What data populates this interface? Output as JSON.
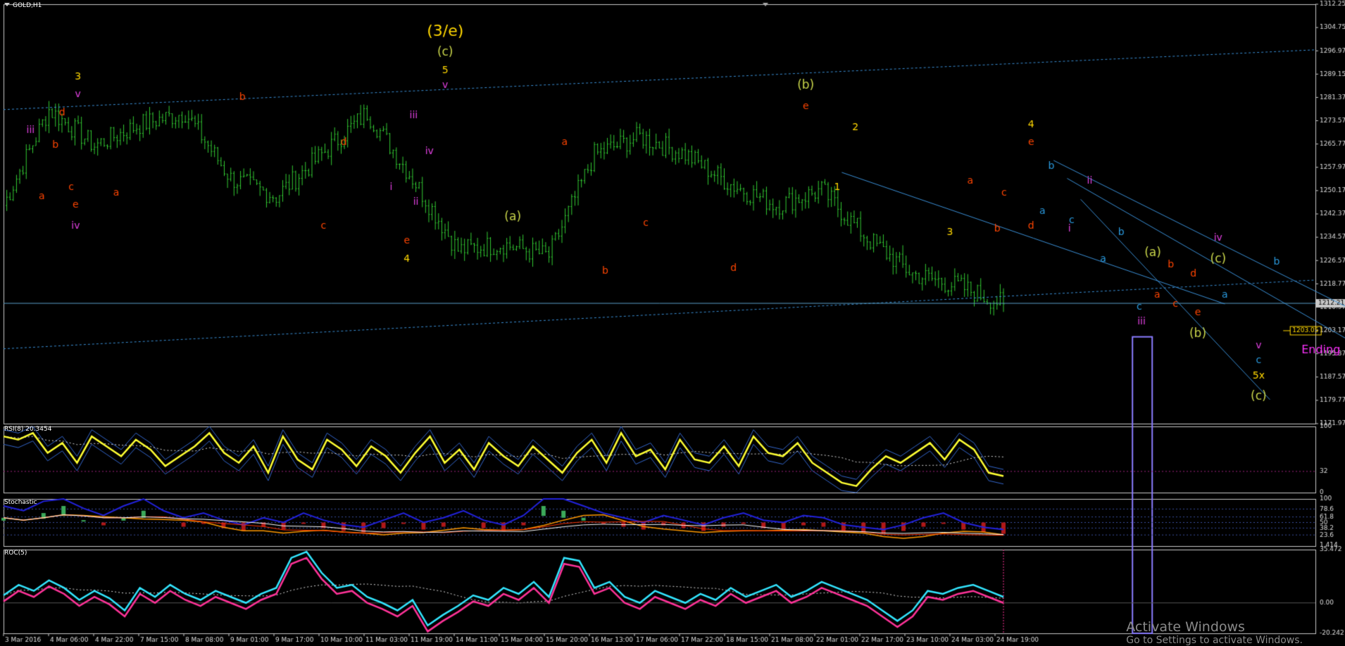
{
  "app": {
    "symbol": "GOLD,H1"
  },
  "panels": {
    "rsi_label": "RSI(8) 20.3454",
    "stoch_label": "Stochastic",
    "roc_label": "ROC(5)"
  },
  "price_axis": {
    "ticks": [
      "1312.25",
      "1304.75",
      "1296.97",
      "1289.15",
      "1281.37",
      "1273.57",
      "1265.77",
      "1257.97",
      "1250.17",
      "1242.37",
      "1234.57",
      "1226.57",
      "1218.77",
      "1210.97",
      "1203.17",
      "1195.37",
      "1187.57",
      "1179.77",
      "1171.97"
    ],
    "current_price": "1212.21",
    "target_label": "1203.05"
  },
  "rsi_axis": [
    "100",
    "32",
    "0"
  ],
  "stoch_axis": [
    "100",
    "78.6",
    "61.8",
    "50",
    "38.2",
    "23.6",
    "1.414"
  ],
  "roc_axis": [
    "35.472",
    "0.00",
    "-20.242"
  ],
  "time_axis": [
    "3 Mar 2016",
    "4 Mar 06:00",
    "4 Mar 22:00",
    "7 Mar 15:00",
    "8 Mar 08:00",
    "9 Mar 01:00",
    "9 Mar 17:00",
    "10 Mar 10:00",
    "11 Mar 03:00",
    "11 Mar 19:00",
    "14 Mar 11:00",
    "15 Mar 04:00",
    "15 Mar 20:00",
    "16 Mar 13:00",
    "17 Mar 06:00",
    "17 Mar 22:00",
    "18 Mar 15:00",
    "21 Mar 08:00",
    "22 Mar 01:00",
    "22 Mar 17:00",
    "23 Mar 10:00",
    "24 Mar 03:00",
    "24 Mar 19:00"
  ],
  "annotation": "Ending Diagonal",
  "watermark": {
    "line1": "Activate Windows",
    "line2": "Go to Settings to activate Windows."
  },
  "colors": {
    "background": "#000000",
    "candles": "#33cc33",
    "rsi": "#ffff33",
    "roc_fast": "#33e6ff",
    "roc_slow": "#ff3399",
    "channel": "#3a8fd6",
    "highlight_box": "#8a7cff",
    "wave_yellow": "#ffd700",
    "wave_olive": "#c8d44a",
    "wave_orange": "#ff4500",
    "wave_magenta": "#e040e0",
    "wave_cyan": "#2a9be0",
    "annotation": "#ff33ff"
  },
  "chart_data": [
    {
      "type": "line",
      "name": "GOLD H1 price",
      "ylim": [
        1171.97,
        1312.25
      ],
      "x": [
        "3 Mar 2016",
        "4 Mar 06:00",
        "4 Mar 22:00",
        "7 Mar 15:00",
        "8 Mar 08:00",
        "9 Mar 01:00",
        "9 Mar 17:00",
        "10 Mar 10:00",
        "11 Mar 03:00",
        "11 Mar 19:00",
        "14 Mar 11:00",
        "15 Mar 04:00",
        "15 Mar 20:00",
        "16 Mar 13:00",
        "17 Mar 06:00",
        "17 Mar 22:00",
        "18 Mar 15:00",
        "21 Mar 08:00",
        "22 Mar 01:00",
        "22 Mar 17:00",
        "23 Mar 10:00",
        "24 Mar 03:00",
        "24 Mar 19:00"
      ],
      "y": [
        1245,
        1277,
        1265,
        1272,
        1276,
        1254,
        1248,
        1262,
        1276,
        1254,
        1230,
        1232,
        1228,
        1262,
        1268,
        1262,
        1252,
        1245,
        1250,
        1234,
        1222,
        1218,
        1212
      ],
      "waves": [
        {
          "label": "(3/e)",
          "color": "#ffd700",
          "t": 9.8,
          "p": 1303
        },
        {
          "label": "(c)",
          "color": "#c8d44a",
          "t": 9.8,
          "p": 1296
        },
        {
          "label": "5",
          "color": "#ffd700",
          "t": 9.8,
          "p": 1290
        },
        {
          "label": "v",
          "color": "#e040e0",
          "t": 9.8,
          "p": 1285
        },
        {
          "label": "3",
          "color": "#ffd700",
          "t": 1.65,
          "p": 1288
        },
        {
          "label": "v",
          "color": "#e040e0",
          "t": 1.65,
          "p": 1282
        },
        {
          "label": "iii",
          "color": "#e040e0",
          "t": 0.6,
          "p": 1270
        },
        {
          "label": "d",
          "color": "#ff4500",
          "t": 1.3,
          "p": 1276
        },
        {
          "label": "b",
          "color": "#ff4500",
          "t": 1.15,
          "p": 1265
        },
        {
          "label": "c",
          "color": "#ff4500",
          "t": 1.5,
          "p": 1251
        },
        {
          "label": "a",
          "color": "#ff4500",
          "t": 0.85,
          "p": 1248
        },
        {
          "label": "e",
          "color": "#ff4500",
          "t": 1.6,
          "p": 1245
        },
        {
          "label": "iv",
          "color": "#e040e0",
          "t": 1.6,
          "p": 1238
        },
        {
          "label": "a",
          "color": "#ff4500",
          "t": 2.5,
          "p": 1249
        },
        {
          "label": "b",
          "color": "#ff4500",
          "t": 5.3,
          "p": 1281
        },
        {
          "label": "d",
          "color": "#ff4500",
          "t": 7.55,
          "p": 1266
        },
        {
          "label": "c",
          "color": "#ff4500",
          "t": 7.1,
          "p": 1238
        },
        {
          "label": "i",
          "color": "#e040e0",
          "t": 8.6,
          "p": 1251
        },
        {
          "label": "ii",
          "color": "#e040e0",
          "t": 9.15,
          "p": 1246
        },
        {
          "label": "iii",
          "color": "#e040e0",
          "t": 9.1,
          "p": 1275
        },
        {
          "label": "iv",
          "color": "#e040e0",
          "t": 9.45,
          "p": 1263
        },
        {
          "label": "e",
          "color": "#ff4500",
          "t": 8.95,
          "p": 1233
        },
        {
          "label": "4",
          "color": "#ffd700",
          "t": 8.95,
          "p": 1227
        },
        {
          "label": "(a)",
          "color": "#c8d44a",
          "t": 11.3,
          "p": 1241
        },
        {
          "label": "a",
          "color": "#ff4500",
          "t": 12.45,
          "p": 1266
        },
        {
          "label": "c",
          "color": "#ff4500",
          "t": 14.25,
          "p": 1239
        },
        {
          "label": "b",
          "color": "#ff4500",
          "t": 13.35,
          "p": 1223
        },
        {
          "label": "d",
          "color": "#ff4500",
          "t": 16.2,
          "p": 1224
        },
        {
          "label": "(b)",
          "color": "#c8d44a",
          "t": 17.8,
          "p": 1285
        },
        {
          "label": "e",
          "color": "#ff4500",
          "t": 17.8,
          "p": 1278
        },
        {
          "label": "2",
          "color": "#ffd700",
          "t": 18.9,
          "p": 1271
        },
        {
          "label": "1",
          "color": "#ffd700",
          "t": 18.5,
          "p": 1251
        },
        {
          "label": "3",
          "color": "#ffd700",
          "t": 21,
          "p": 1236
        },
        {
          "label": "a",
          "color": "#ff4500",
          "t": 21.45,
          "p": 1253
        },
        {
          "label": "c",
          "color": "#ff4500",
          "t": 22.2,
          "p": 1249
        },
        {
          "label": "b",
          "color": "#ff4500",
          "t": 22.05,
          "p": 1237
        },
        {
          "label": "d",
          "color": "#ff4500",
          "t": 22.8,
          "p": 1238
        },
        {
          "label": "4",
          "color": "#ffd700",
          "t": 22.8,
          "p": 1272
        },
        {
          "label": "e",
          "color": "#ff4500",
          "t": 22.8,
          "p": 1266
        },
        {
          "label": "ii",
          "color": "#e040e0",
          "t": 24.1,
          "p": 1253
        },
        {
          "label": "i",
          "color": "#e040e0",
          "t": 23.65,
          "p": 1237
        },
        {
          "label": "(a)",
          "color": "#c8d44a",
          "t": 25.5,
          "p": 1229
        },
        {
          "label": "b",
          "color": "#ff4500",
          "t": 25.9,
          "p": 1225
        },
        {
          "label": "d",
          "color": "#ff4500",
          "t": 26.4,
          "p": 1222
        },
        {
          "label": "a",
          "color": "#ff4500",
          "t": 25.6,
          "p": 1215
        },
        {
          "label": "c",
          "color": "#ff4500",
          "t": 26,
          "p": 1212
        },
        {
          "label": "e",
          "color": "#ff4500",
          "t": 26.5,
          "p": 1209
        },
        {
          "label": "iii",
          "color": "#e040e0",
          "t": 25.25,
          "p": 1206
        },
        {
          "label": "(b)",
          "color": "#c8d44a",
          "t": 26.5,
          "p": 1202
        },
        {
          "label": "(c)",
          "color": "#c8d44a",
          "t": 26.95,
          "p": 1227
        },
        {
          "label": "iv",
          "color": "#e040e0",
          "t": 26.95,
          "p": 1234
        },
        {
          "label": "v",
          "color": "#e040e0",
          "t": 27.85,
          "p": 1198
        },
        {
          "label": "5x",
          "color": "#ffd700",
          "t": 27.85,
          "p": 1188
        },
        {
          "label": "(c)",
          "color": "#c8d44a",
          "t": 27.85,
          "p": 1181
        },
        {
          "label": "b",
          "color": "#2a9be0",
          "t": 23.25,
          "p": 1258
        },
        {
          "label": "a",
          "color": "#2a9be0",
          "t": 23.05,
          "p": 1243
        },
        {
          "label": "c",
          "color": "#2a9be0",
          "t": 23.7,
          "p": 1240
        },
        {
          "label": "b",
          "color": "#2a9be0",
          "t": 24.8,
          "p": 1236
        },
        {
          "label": "a",
          "color": "#2a9be0",
          "t": 24.4,
          "p": 1227
        },
        {
          "label": "c",
          "color": "#2a9be0",
          "t": 25.2,
          "p": 1211
        },
        {
          "label": "a",
          "color": "#2a9be0",
          "t": 27.1,
          "p": 1215
        },
        {
          "label": "b",
          "color": "#2a9be0",
          "t": 28.25,
          "p": 1226
        },
        {
          "label": "c",
          "color": "#2a9be0",
          "t": 27.85,
          "p": 1193
        }
      ]
    },
    {
      "type": "line",
      "name": "RSI(8)",
      "ylim": [
        0,
        100
      ],
      "y": [
        85,
        80,
        90,
        60,
        75,
        45,
        85,
        70,
        55,
        80,
        65,
        40,
        55,
        70,
        90,
        60,
        45,
        70,
        30,
        85,
        50,
        35,
        80,
        65,
        40,
        70,
        55,
        30,
        60,
        85,
        45,
        65,
        35,
        75,
        55,
        40,
        70,
        50,
        30,
        60,
        80,
        45,
        90,
        55,
        65,
        35,
        80,
        50,
        45,
        70,
        40,
        85,
        60,
        55,
        75,
        45,
        30,
        15,
        10,
        35,
        55,
        45,
        60,
        75,
        50,
        80,
        65,
        30,
        25
      ]
    },
    {
      "type": "line",
      "name": "Stochastic",
      "ylim": [
        0,
        100
      ],
      "y": [
        60,
        50,
        70,
        85,
        55,
        40,
        60,
        75,
        50,
        35,
        45,
        30,
        20,
        35,
        25,
        45,
        30,
        20,
        15,
        30,
        45,
        25,
        35,
        50,
        30,
        20,
        40,
        85,
        75,
        60,
        45,
        35,
        25,
        40,
        30,
        20,
        35,
        45,
        30,
        25,
        40,
        35,
        20,
        15,
        10,
        20,
        35,
        45,
        25,
        15,
        10
      ]
    },
    {
      "type": "line",
      "name": "ROC(5)",
      "ylim": [
        -20.242,
        35.472
      ],
      "y": [
        5,
        12,
        8,
        15,
        10,
        2,
        8,
        3,
        -5,
        10,
        4,
        12,
        6,
        2,
        8,
        4,
        0,
        6,
        10,
        30,
        34,
        20,
        10,
        12,
        4,
        0,
        -5,
        2,
        -15,
        -8,
        -2,
        5,
        2,
        10,
        6,
        14,
        4,
        30,
        28,
        10,
        14,
        4,
        0,
        8,
        4,
        0,
        6,
        2,
        10,
        4,
        8,
        12,
        4,
        8,
        14,
        10,
        6,
        2,
        -5,
        -12,
        -5,
        8,
        6,
        10,
        12,
        8,
        4
      ]
    }
  ]
}
